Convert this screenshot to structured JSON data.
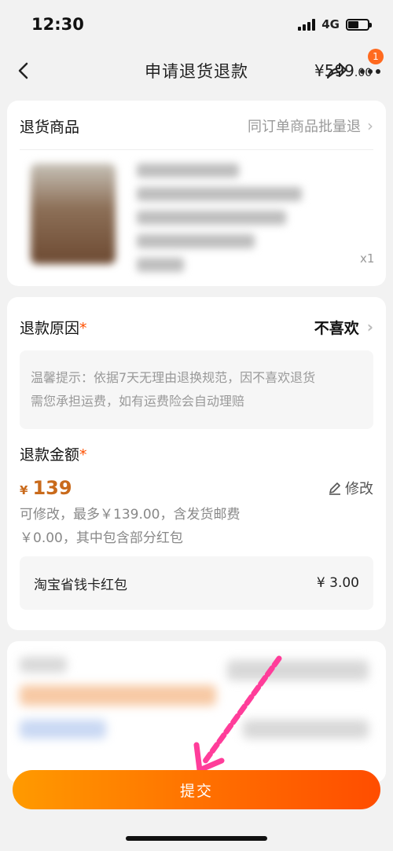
{
  "status": {
    "time": "12:30",
    "network": "4G",
    "battery_level": 0.55
  },
  "header": {
    "title": "申请退货退款",
    "badge_count": "1"
  },
  "goods": {
    "section_title": "退货商品",
    "batch_link": "同订单商品批量退",
    "price_main": "¥599",
    "price_decimal": ".00",
    "quantity": "x1"
  },
  "refund": {
    "reason_label": "退款原因",
    "required_mark": "*",
    "reason_value": "不喜欢",
    "tip_line1": "温馨提示：依据7天无理由退换规范，因不喜欢退货",
    "tip_line2": "需您承担运费，如有运费险会自动理赔",
    "amount_label": "退款金额",
    "amount_currency": "¥",
    "amount_value": "139",
    "edit_label": "修改",
    "note_line1": "可修改，最多￥139.00，含发货邮费",
    "note_line2": "￥0.00，其中包含部分红包",
    "redpack_label": "淘宝省钱卡红包",
    "redpack_value": "¥ 3.00"
  },
  "footer": {
    "submit_label": "提交"
  },
  "colors": {
    "accent": "#ff6a00",
    "amount": "#c96a1b",
    "badge": "#ff6a1f"
  },
  "icons": {
    "back": "chevron-left-icon",
    "share": "share-icon",
    "more": "more-dots-icon",
    "edit": "pencil-icon"
  }
}
